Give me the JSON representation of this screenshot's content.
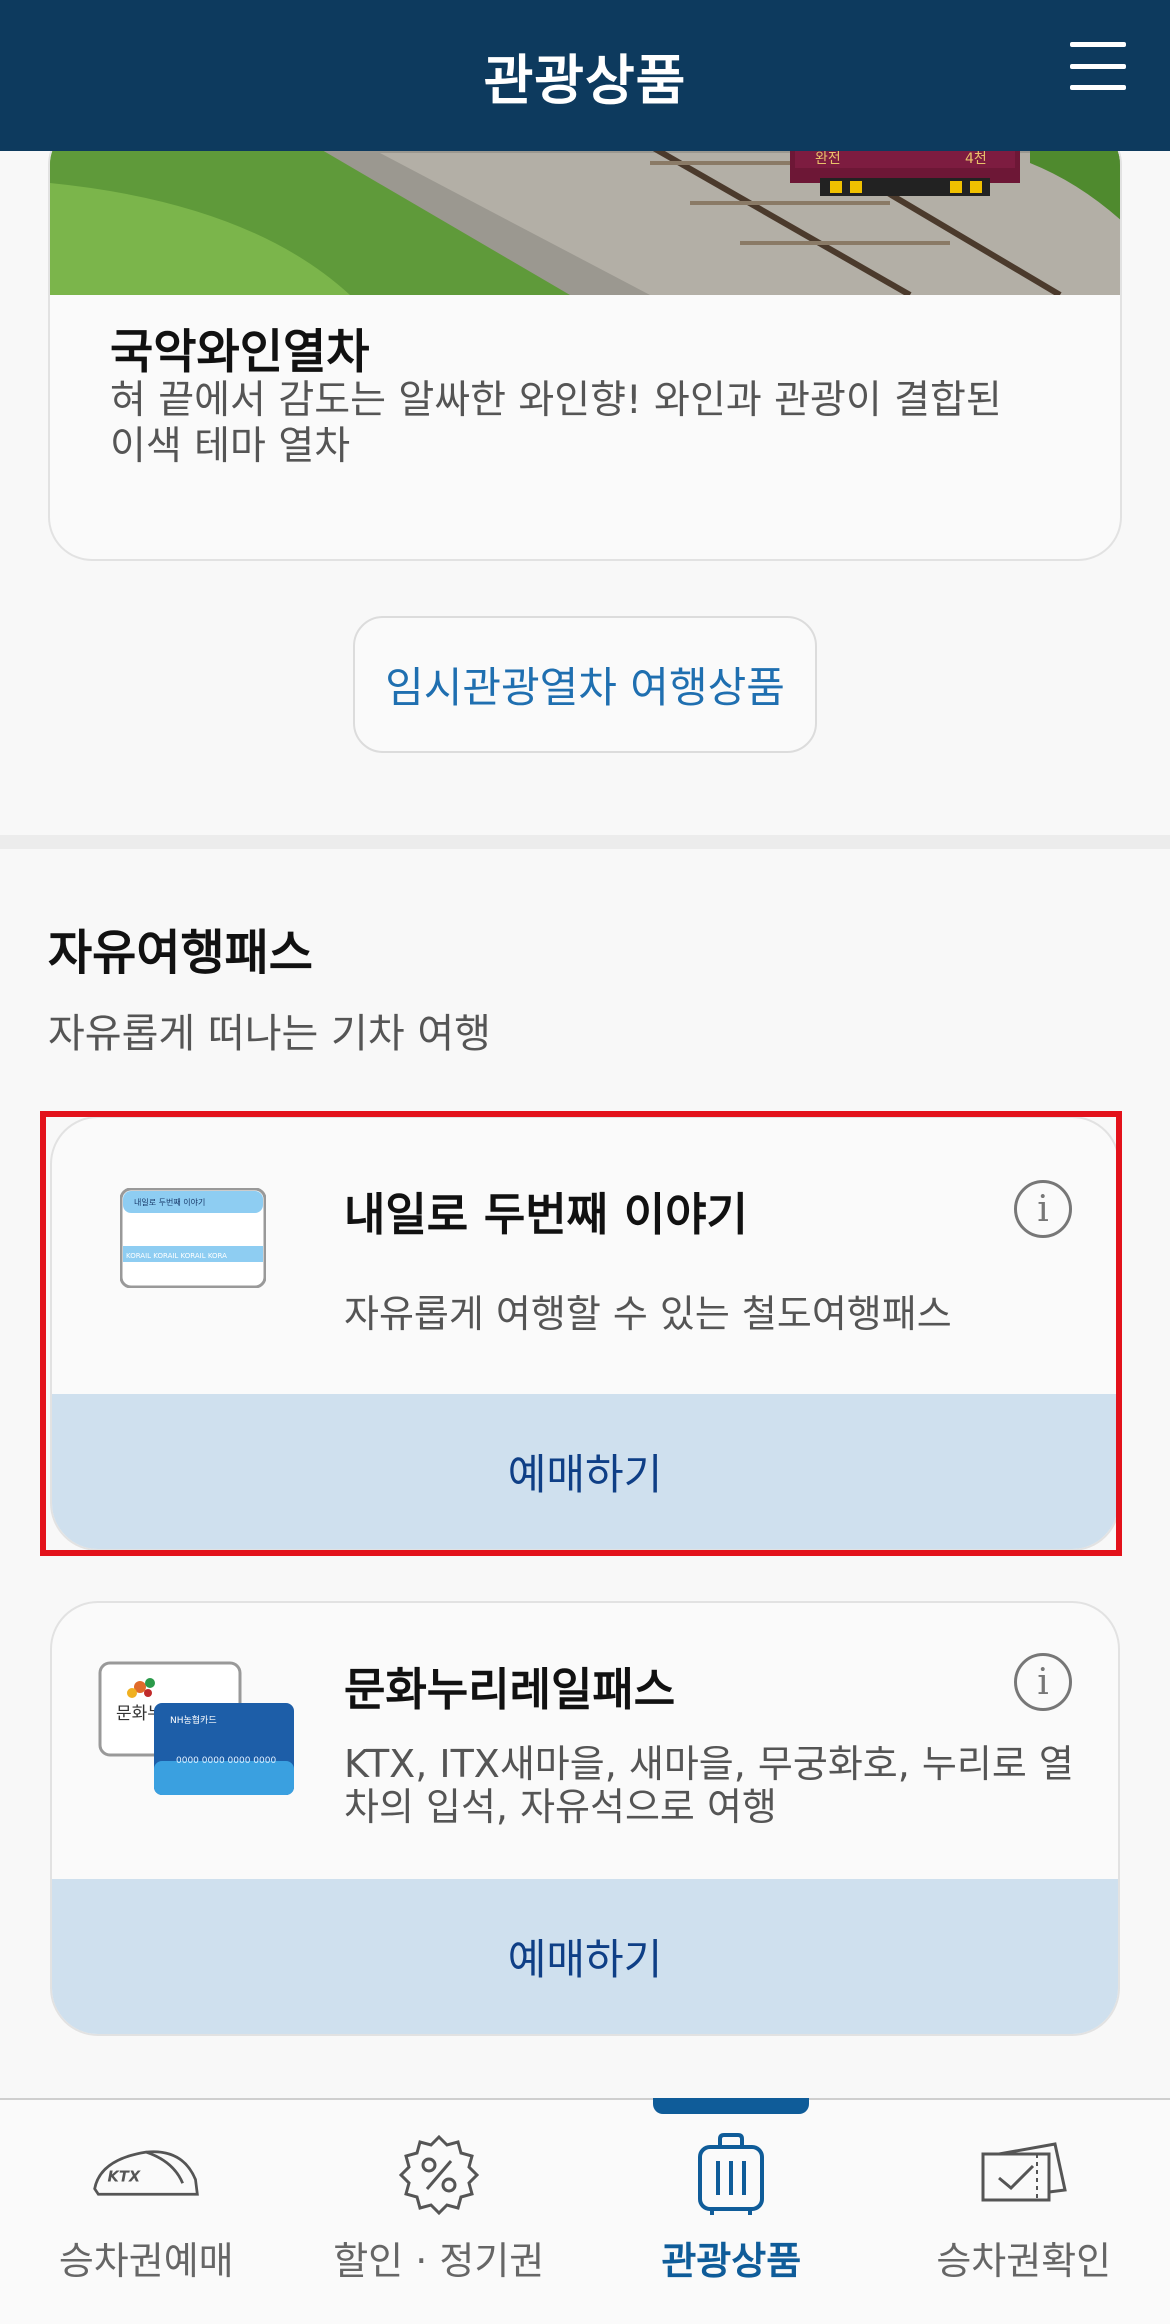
{
  "header": {
    "title": "관광상품",
    "menu_icon": "hamburger-menu-icon"
  },
  "tour_card": {
    "title": "국악와인열차",
    "description": "혀 끝에서 감도는 알싸한 와인향! 와인과 관광이 결합된 이색 테마 열차",
    "image": "train-photo",
    "train_sign_left": "완전",
    "train_sign_right": "4천"
  },
  "temp_button": {
    "label": "임시관광열차 여행상품"
  },
  "free_pass_section": {
    "title": "자유여행패스",
    "subtitle": "자유롭게 떠나는 기차 여행"
  },
  "passes": [
    {
      "title": "내일로 두번째 이야기",
      "description": "자유롭게 여행할 수 있는 철도여행패스",
      "book_label": "예매하기",
      "card_image_text": "내일로 두번째 이야기",
      "card_stripe_text": "KORAIL KORAIL KORAIL KORA"
    },
    {
      "title": "문화누리레일패스",
      "description": "KTX, ITX새마을, 새마을, 무궁화호, 누리로 열차의 입석, 자유석으로 여행",
      "book_label": "예매하기",
      "card_front_text": "문화누",
      "card_back_label": "NH농협카드",
      "card_number": "0000 0000 0000 0000"
    }
  ],
  "colors": {
    "header_bg": "#0d3a5e",
    "accent": "#0f5c99",
    "book_bg": "#cfe0ee",
    "highlight": "#e3121b"
  },
  "bottom_nav": [
    {
      "label": "승차권예매",
      "icon": "ktx-train-icon",
      "active": false,
      "icon_text": "KTX"
    },
    {
      "label": "할인 · 정기권",
      "icon": "discount-percent-icon",
      "active": false
    },
    {
      "label": "관광상품",
      "icon": "suitcase-icon",
      "active": true
    },
    {
      "label": "승차권확인",
      "icon": "ticket-check-icon",
      "active": false
    }
  ]
}
